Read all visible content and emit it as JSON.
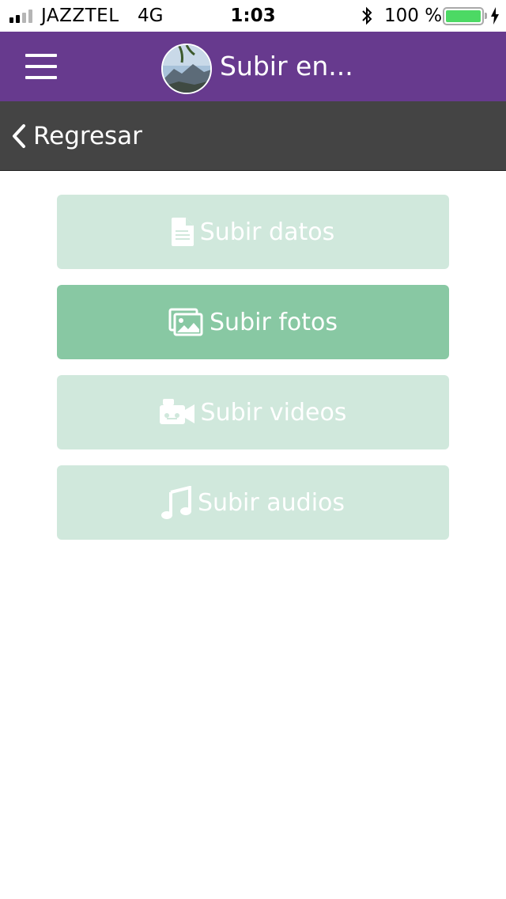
{
  "status_bar": {
    "carrier": "JAZZTEL",
    "network": "4G",
    "time": "1:03",
    "battery_percent": "100 %",
    "signal_bars": 2,
    "battery_level": 1.0,
    "battery_color": "#4cd964"
  },
  "header": {
    "title": "Subir en...",
    "background": "#673a8e",
    "menu_icon": "hamburger-icon",
    "avatar": "avatar"
  },
  "back_bar": {
    "label": "Regresar",
    "icon": "chevron-left-icon",
    "background": "#444444"
  },
  "actions": [
    {
      "label": "Subir datos",
      "icon": "document-icon",
      "active": false
    },
    {
      "label": "Subir fotos",
      "icon": "images-icon",
      "active": true
    },
    {
      "label": "Subir videos",
      "icon": "video-camera-icon",
      "active": false
    },
    {
      "label": "Subir audios",
      "icon": "music-note-icon",
      "active": false
    }
  ],
  "colors": {
    "button_active": "#88c8a3",
    "button_inactive": "#d0e8dc"
  }
}
